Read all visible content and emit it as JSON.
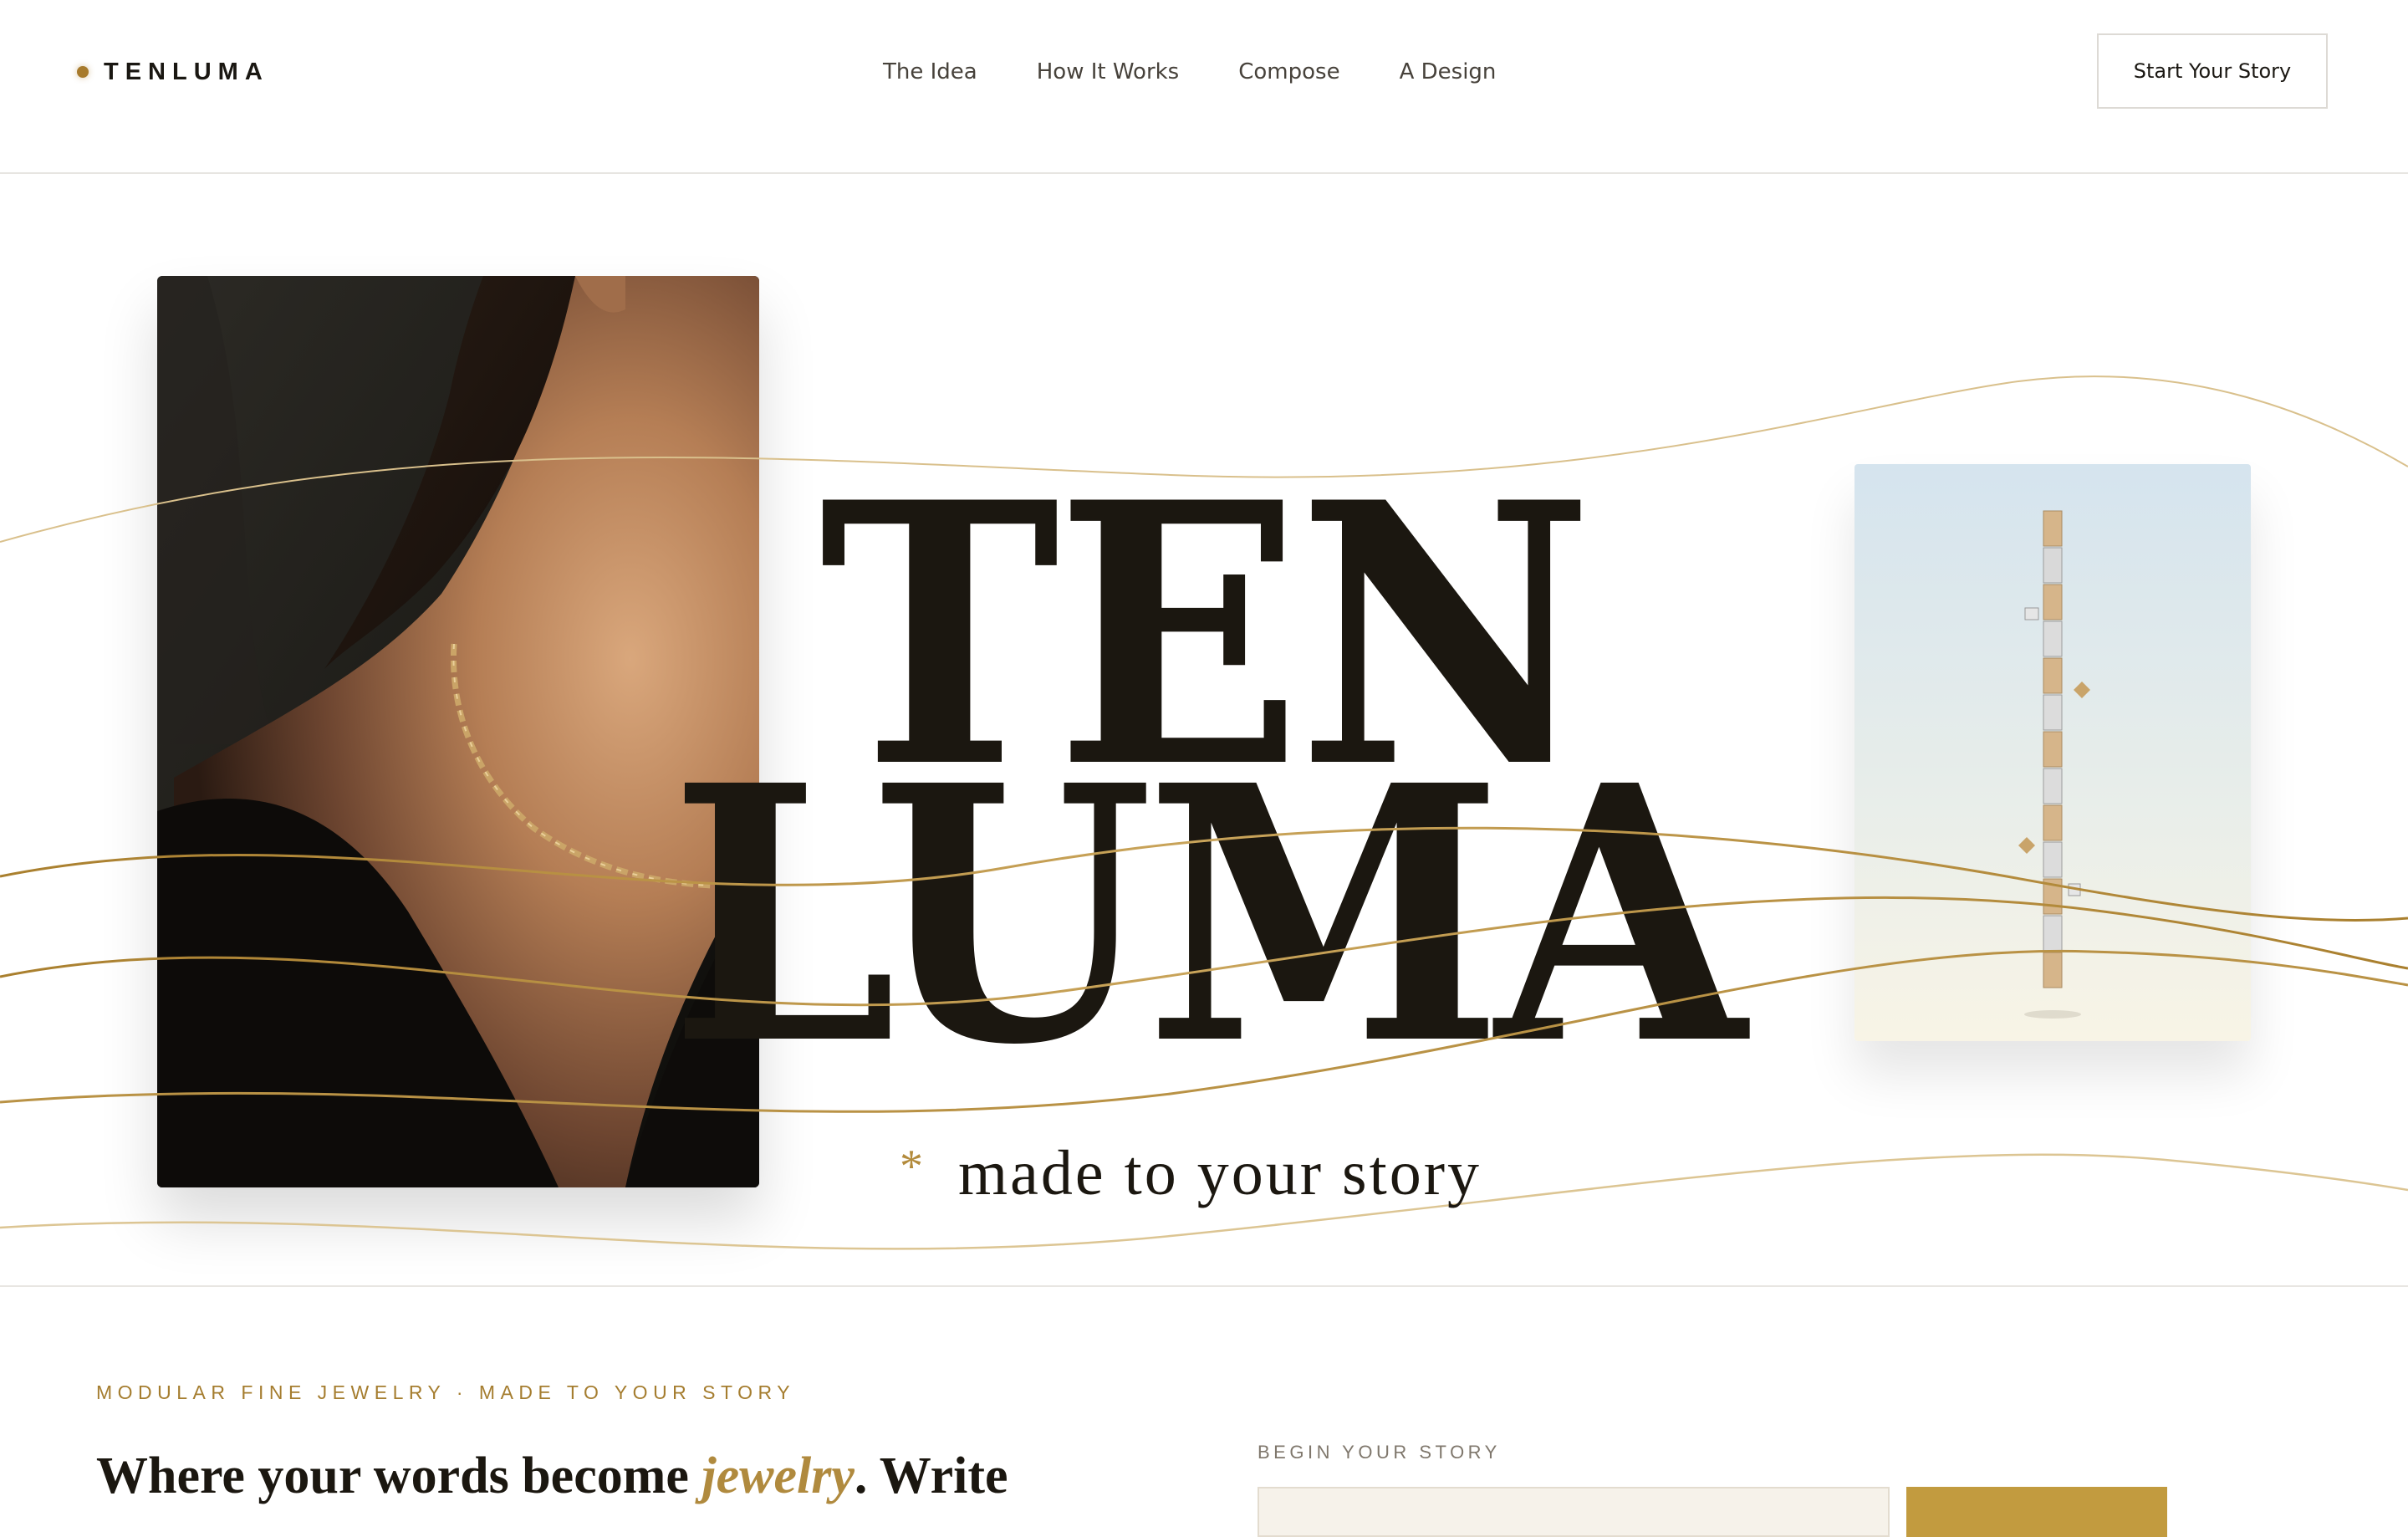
{
  "brand": {
    "name": "TENLUMA",
    "dot_color": "#a77a2c"
  },
  "nav": {
    "items": [
      "The Idea",
      "How It Works",
      "Compose",
      "A Design"
    ]
  },
  "header": {
    "cta_label": "Start Your Story"
  },
  "hero": {
    "wordmark_line1": "TEN",
    "wordmark_line2": "LUMA",
    "tagline_mark": "*",
    "tagline": "made to your story",
    "left_image": "woman-with-gold-chain-necklace",
    "right_image": "modular-bracelet-on-sky-gradient"
  },
  "intro": {
    "eyebrow": "MODULAR FINE JEWELRY · MADE TO YOUR STORY",
    "headline_part1": "Where your words become ",
    "headline_emphasis": "jewelry",
    "headline_part2": ". Write"
  },
  "story_form": {
    "label": "BEGIN YOUR STORY",
    "input_value": "",
    "input_placeholder": "",
    "button_label": ""
  },
  "colors": {
    "accent_gold": "#b08a3e",
    "text_dark": "#1b1710",
    "button_gold": "#c29b3f"
  }
}
